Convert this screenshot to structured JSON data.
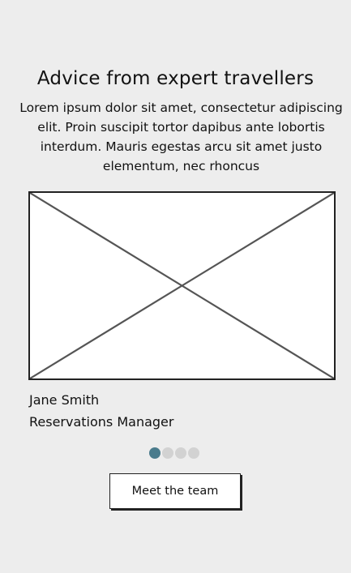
{
  "section": {
    "title": "Advice from expert travellers",
    "intro": "Lorem ipsum dolor sit amet, consectetur adipiscing elit. Proin suscipit tortor dapibus ante lobortis interdum. Mauris egestas arcu sit amet justo elementum, nec rhoncus"
  },
  "testimonial": {
    "image_icon": "image-placeholder-icon",
    "name": "Jane Smith",
    "role": "Reservations Manager"
  },
  "carousel": {
    "total_slides": 4,
    "active_slide": 1,
    "active_color": "#4a7b8c",
    "inactive_color": "#d2d2d2"
  },
  "cta": {
    "label": "Meet the team"
  }
}
